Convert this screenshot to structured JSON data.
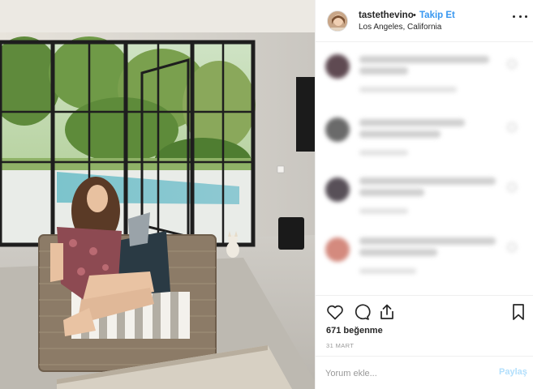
{
  "post": {
    "username": "tastethevino",
    "separator": "•",
    "follow_label": "Takip Et",
    "location": "Los Angeles, California",
    "likes_text": "671 beğenme",
    "date_text": "31 MART"
  },
  "comment_bar": {
    "placeholder": "Yorum ekle...",
    "submit_label": "Paylaş"
  },
  "icons": {
    "like": "heart-icon",
    "comment": "speech-bubble-icon",
    "share": "share-icon",
    "save": "bookmark-icon",
    "more": "ellipsis-icon"
  },
  "colors": {
    "link_blue": "#3897f0",
    "disabled_blue": "#b2dffc",
    "text": "#262626",
    "muted": "#999999",
    "divider": "#efefef"
  }
}
